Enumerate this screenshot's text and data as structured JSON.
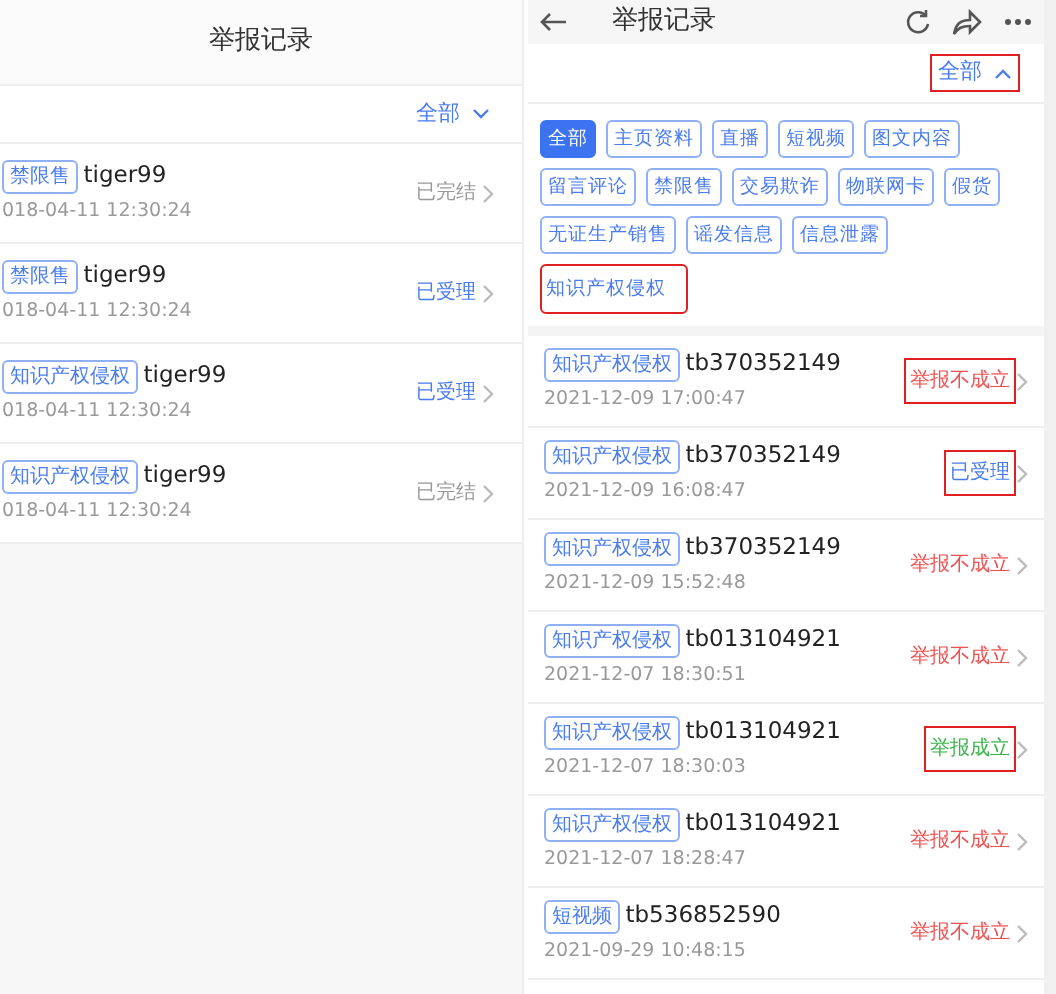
{
  "left_screen": {
    "title": "举报记录",
    "filter": {
      "label": "全部",
      "expanded": false
    },
    "records": [
      {
        "tag": "禁限售",
        "user": "tiger99",
        "time": "018-04-11 12:30:24",
        "status": "已完结",
        "kind": "closed"
      },
      {
        "tag": "禁限售",
        "user": "tiger99",
        "time": "018-04-11 12:30:24",
        "status": "已受理",
        "kind": "accepted"
      },
      {
        "tag": "知识产权侵权",
        "user": "tiger99",
        "time": "018-04-11 12:30:24",
        "status": "已受理",
        "kind": "accepted"
      },
      {
        "tag": "知识产权侵权",
        "user": "tiger99",
        "time": "018-04-11 12:30:24",
        "status": "已完结",
        "kind": "closed"
      }
    ]
  },
  "right_screen": {
    "title": "举报记录",
    "filter": {
      "label": "全部",
      "expanded": true,
      "highlighted": true
    },
    "categories": [
      {
        "label": "全部",
        "selected": true,
        "highlighted": false
      },
      {
        "label": "主页资料",
        "selected": false,
        "highlighted": false
      },
      {
        "label": "直播",
        "selected": false,
        "highlighted": false
      },
      {
        "label": "短视频",
        "selected": false,
        "highlighted": false
      },
      {
        "label": "图文内容",
        "selected": false,
        "highlighted": false
      },
      {
        "label": "留言评论",
        "selected": false,
        "highlighted": false
      },
      {
        "label": "禁限售",
        "selected": false,
        "highlighted": false
      },
      {
        "label": "交易欺诈",
        "selected": false,
        "highlighted": false
      },
      {
        "label": "物联网卡",
        "selected": false,
        "highlighted": false
      },
      {
        "label": "假货",
        "selected": false,
        "highlighted": false
      },
      {
        "label": "无证生产销售",
        "selected": false,
        "highlighted": false
      },
      {
        "label": "谣发信息",
        "selected": false,
        "highlighted": false
      },
      {
        "label": "信息泄露",
        "selected": false,
        "highlighted": false
      },
      {
        "label": "知识产权侵权",
        "selected": false,
        "highlighted": true
      }
    ],
    "records": [
      {
        "tag": "知识产权侵权",
        "user": "tb370352149",
        "time": "2021-12-09 17:00:47",
        "status": "举报不成立",
        "kind": "rejected",
        "highlighted": true
      },
      {
        "tag": "知识产权侵权",
        "user": "tb370352149",
        "time": "2021-12-09 16:08:47",
        "status": "已受理",
        "kind": "accepted",
        "highlighted": true
      },
      {
        "tag": "知识产权侵权",
        "user": "tb370352149",
        "time": "2021-12-09 15:52:48",
        "status": "举报不成立",
        "kind": "rejected",
        "highlighted": false
      },
      {
        "tag": "知识产权侵权",
        "user": "tb013104921",
        "time": "2021-12-07 18:30:51",
        "status": "举报不成立",
        "kind": "rejected",
        "highlighted": false
      },
      {
        "tag": "知识产权侵权",
        "user": "tb013104921",
        "time": "2021-12-07 18:30:03",
        "status": "举报成立",
        "kind": "upheld",
        "highlighted": true
      },
      {
        "tag": "知识产权侵权",
        "user": "tb013104921",
        "time": "2021-12-07 18:28:47",
        "status": "举报不成立",
        "kind": "rejected",
        "highlighted": false
      },
      {
        "tag": "短视频",
        "user": "tb536852590",
        "time": "2021-09-29 10:48:15",
        "status": "举报不成立",
        "kind": "rejected",
        "highlighted": false
      }
    ]
  }
}
